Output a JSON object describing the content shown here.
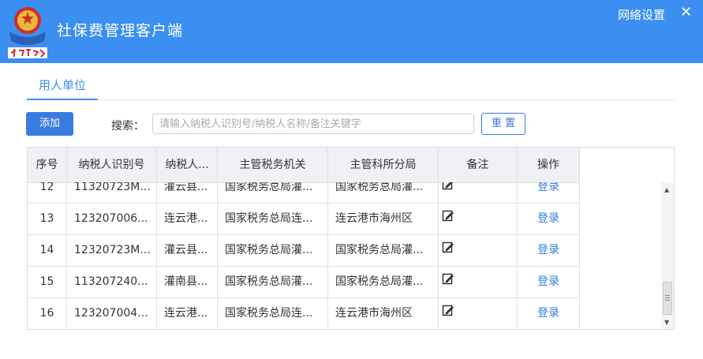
{
  "header": {
    "title": "社保费管理客户端",
    "network_settings": "网络设置",
    "close_label": "✕",
    "logo_text": "中国税务",
    "colors": {
      "background": "#3b8ff0",
      "text": "#ffffff"
    }
  },
  "tabs": [
    {
      "label": "用人单位",
      "active": true
    }
  ],
  "toolbar": {
    "add_label": "添加",
    "search_label": "搜索：",
    "search_placeholder": "请输入纳税人识别号/纳税人名称/备注关键字",
    "search_value": "",
    "reset_label": "重 置"
  },
  "table": {
    "headers": [
      "序号",
      "纳税人识别号",
      "纳税人...",
      "主管税务机关",
      "主管科所分局",
      "备注",
      "操作"
    ],
    "rows": [
      {
        "index": "12",
        "taxpayer_id": "11320723M...",
        "taxpayer_name": "灌云县...",
        "tax_authority": "国家税务总局灌...",
        "tax_office": "国家税务总局灌...",
        "note_icon": "edit-note-icon",
        "action": "登录"
      },
      {
        "index": "13",
        "taxpayer_id": "123207006...",
        "taxpayer_name": "连云港...",
        "tax_authority": "国家税务总局连...",
        "tax_office": "连云港市海州区",
        "note_icon": "edit-note-icon",
        "action": "登录"
      },
      {
        "index": "14",
        "taxpayer_id": "12320723M...",
        "taxpayer_name": "灌云县...",
        "tax_authority": "国家税务总局灌...",
        "tax_office": "国家税务总局灌...",
        "note_icon": "edit-note-icon",
        "action": "登录"
      },
      {
        "index": "15",
        "taxpayer_id": "113207240...",
        "taxpayer_name": "灌南县...",
        "tax_authority": "国家税务总局灌...",
        "tax_office": "国家税务总局灌...",
        "note_icon": "edit-note-icon",
        "action": "登录"
      },
      {
        "index": "16",
        "taxpayer_id": "123207004...",
        "taxpayer_name": "连云港...",
        "tax_authority": "国家税务总局连...",
        "tax_office": "连云港市海州区",
        "note_icon": "edit-note-icon",
        "action": "登录"
      }
    ]
  },
  "scrollbar": {
    "position": 0.85
  },
  "accent_color": "#3a7be0"
}
